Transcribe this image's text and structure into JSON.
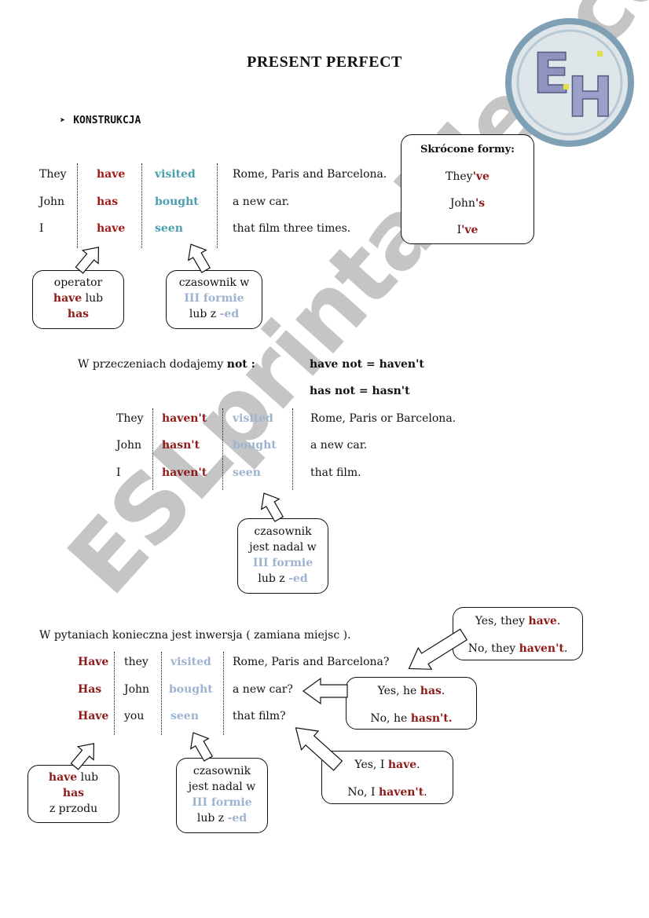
{
  "title": "PRESENT PERFECT",
  "section_heading": {
    "bullet_icon": "arrowhead-bullet",
    "label": "KONSTRUKCJA"
  },
  "logo": {
    "letters": "E H",
    "colors": {
      "ring": "#7fa0b4",
      "letter": "#9098c0",
      "accent": "#e0e040"
    }
  },
  "colors": {
    "operator": "#a11a1a",
    "participle_affirmative": "#4a9eae",
    "participle_other": "#9db3cf"
  },
  "affirmative": {
    "rows": [
      {
        "subject": "They",
        "operator": "have",
        "verb": "visited",
        "rest": "Rome, Paris and Barcelona."
      },
      {
        "subject": "John",
        "operator": "has",
        "verb": "bought",
        "rest": "a new car."
      },
      {
        "subject": "I",
        "operator": "have",
        "verb": "seen",
        "rest": "that film three times."
      }
    ],
    "note_operator": {
      "line1": "operator",
      "line2_bold": "have",
      "line2_rest": " lub",
      "line3_bold": "has"
    },
    "note_verb": {
      "line1": "czasownik w",
      "line2": "III formie",
      "line3_pre": "lub z ",
      "line3_suffix": "-ed"
    }
  },
  "short_forms": {
    "title": "Skrócone formy:",
    "items": [
      {
        "base": "They",
        "suffix": "'ve"
      },
      {
        "base": "John",
        "suffix": "'s"
      },
      {
        "base": "I",
        "suffix": "'ve"
      }
    ]
  },
  "negative": {
    "intro_text": "W przeczeniach dodajemy ",
    "intro_bold": "not :",
    "rule1": "have not  = haven't",
    "rule2": "has not  = hasn't",
    "rows": [
      {
        "subject": "They",
        "operator": "haven't",
        "verb": "visited",
        "rest": "Rome, Paris or Barcelona."
      },
      {
        "subject": "John",
        "operator": "hasn't",
        "verb": "bought",
        "rest": "a new car."
      },
      {
        "subject": "I",
        "operator": "haven't",
        "verb": "seen",
        "rest": "that film."
      }
    ],
    "note_verb": {
      "line1": "czasownik",
      "line2": "jest nadal w",
      "line3": "III formie",
      "line4_pre": "lub z ",
      "line4_suffix": "-ed"
    }
  },
  "questions": {
    "intro": "W pytaniach konieczna jest inwersja ( zamiana miejsc ).",
    "rows": [
      {
        "operator": "Have",
        "subject": "they",
        "verb": "visited",
        "rest": "Rome, Paris and Barcelona?"
      },
      {
        "operator": "Has",
        "subject": "John",
        "verb": "bought",
        "rest": "a new car?"
      },
      {
        "operator": "Have",
        "subject": "you",
        "verb": "seen",
        "rest": "that film?"
      }
    ],
    "answers": [
      {
        "yes_pre": "Yes, they ",
        "yes_bold": "have",
        "no_pre": "No, they ",
        "no_bold": "haven't"
      },
      {
        "yes_pre": "Yes, he ",
        "yes_bold": "has",
        "no_pre": "No, he ",
        "no_bold": "hasn't."
      },
      {
        "yes_pre": "Yes, I ",
        "yes_bold": "have",
        "no_pre": "No, I ",
        "no_bold": "haven't"
      }
    ],
    "note_operator": {
      "line1_bold": "have",
      "line1_rest": " lub",
      "line2_bold": "has",
      "line3": "z przodu"
    },
    "note_verb": {
      "line1": "czasownik",
      "line2": "jest nadal w",
      "line3": "III formie",
      "line4_pre": "lub z ",
      "line4_suffix": "-ed"
    }
  },
  "watermark": "ESLprintables.com"
}
